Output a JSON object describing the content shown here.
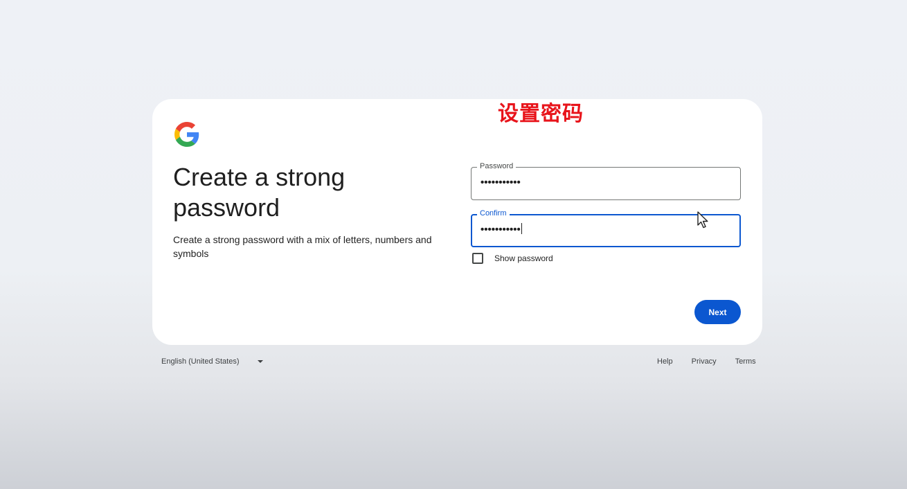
{
  "overlay": {
    "caption": "设置密码"
  },
  "header": {
    "logo_icon": "google-g-icon",
    "title": "Create a strong password",
    "subtitle": "Create a strong password with a mix of letters, numbers and symbols"
  },
  "form": {
    "password": {
      "label": "Password",
      "value": "•••••••••••"
    },
    "confirm": {
      "label": "Confirm",
      "value": "•••••••••••"
    },
    "show_password": {
      "label": "Show password",
      "checked": false
    },
    "next_label": "Next"
  },
  "footer": {
    "language": "English (United States)",
    "links": {
      "help": "Help",
      "privacy": "Privacy",
      "terms": "Terms"
    }
  },
  "colors": {
    "accent": "#0b57d0",
    "caption": "#e8141b"
  }
}
